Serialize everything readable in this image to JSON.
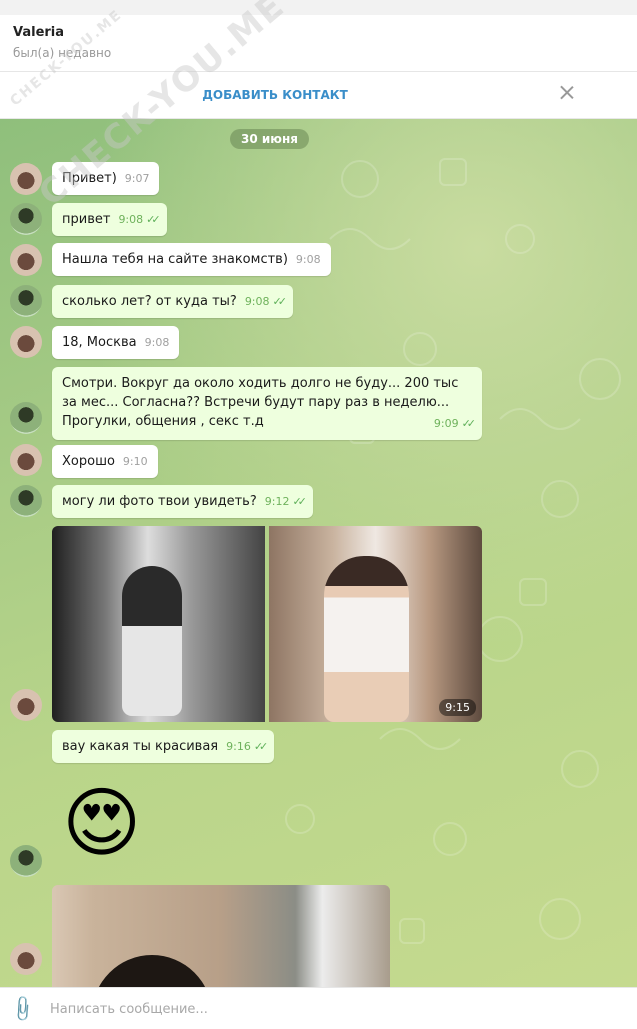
{
  "header": {
    "name": "Valeria",
    "status": "был(а) недавно"
  },
  "add_contact": {
    "label": "ДОБАВИТЬ КОНТАКТ"
  },
  "watermark": {
    "text": "CHECK-YOU.ME",
    "small": "CHECK-YOU.ME"
  },
  "chat": {
    "date": "30 июня",
    "messages": [
      {
        "dir": "in",
        "text": "Привет)",
        "time": "9:07"
      },
      {
        "dir": "out",
        "text": "привет",
        "time": "9:08"
      },
      {
        "dir": "in",
        "text": "Нашла тебя на сайте знакомств)",
        "time": "9:08"
      },
      {
        "dir": "out",
        "text": "сколько лет? от куда ты?",
        "time": "9:08"
      },
      {
        "dir": "in",
        "text": "18, Москва",
        "time": "9:08"
      },
      {
        "dir": "out",
        "text": "Смотри. Вокруг да около ходить долго не буду... 200 тыс за мес... Согласна?? Встречи будут пару раз в неделю... Прогулки, общения , секс т.д",
        "time": "9:09"
      },
      {
        "dir": "in",
        "text": "Хорошо",
        "time": "9:10"
      },
      {
        "dir": "out",
        "text": "могу ли фото твои увидеть?",
        "time": "9:12"
      },
      {
        "dir": "in",
        "type": "photos",
        "time": "9:15"
      },
      {
        "dir": "out",
        "text": "вау какая ты красивая",
        "time": "9:16"
      },
      {
        "dir": "out",
        "type": "emoji",
        "text": "😍"
      },
      {
        "dir": "in",
        "type": "photo"
      }
    ]
  },
  "composer": {
    "placeholder": "Написать сообщение..."
  },
  "colors": {
    "accent": "#3a8ec9",
    "out_bubble": "#eeffde",
    "ticks": "#5fb05a"
  }
}
